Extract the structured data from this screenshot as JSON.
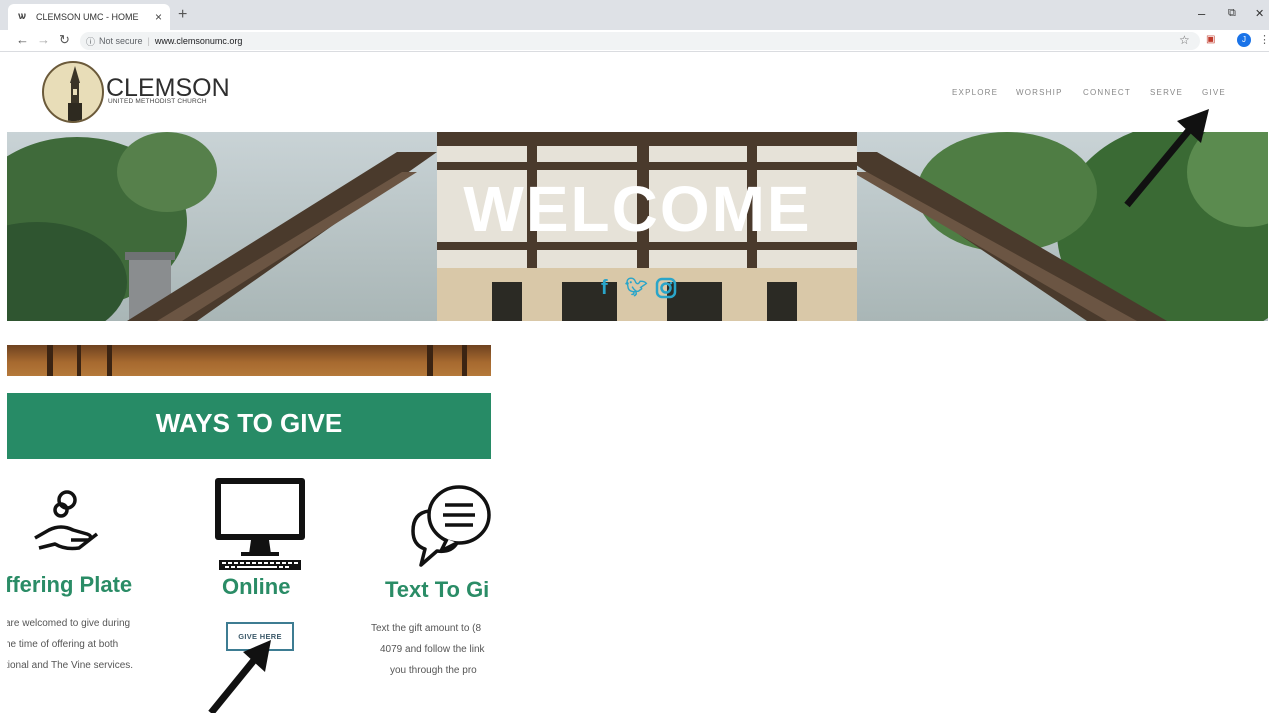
{
  "browser": {
    "tab_title": "CLEMSON UMC - HOME",
    "tab_close": "×",
    "new_tab": "+",
    "security_label": "Not secure",
    "url": "www.clemsonumc.org",
    "avatar_letter": "J",
    "window_controls": {
      "minimize": "–",
      "restore": "⧉",
      "close": "✕"
    }
  },
  "site": {
    "logo_name": "CLEMSON",
    "logo_subtitle": "UNITED METHODIST CHURCH",
    "nav": [
      "EXPLORE",
      "WORSHIP",
      "CONNECT",
      "SERVE",
      "GIVE"
    ],
    "hero_title": "WELCOME",
    "social_icons": [
      "facebook-icon",
      "twitter-icon",
      "instagram-icon"
    ]
  },
  "give_section": {
    "heading": "WAYS TO GIVE",
    "columns": [
      {
        "title": "ffering Plate",
        "icon": "hand-coins-icon",
        "lines": [
          "are welcomed to give during",
          "ne time of offering at both",
          "tional and The Vine services."
        ]
      },
      {
        "title": "Online",
        "icon": "computer-icon",
        "button": "GIVE HERE"
      },
      {
        "title": "Text To Gi",
        "icon": "chat-bubbles-icon",
        "lines": [
          "Text the gift amount to (8",
          "4079 and follow the link",
          "you through the pro"
        ]
      }
    ]
  },
  "colors": {
    "brand_green": "#278b66",
    "button_border": "#3d7c92",
    "annotation_arrow": "#111111"
  }
}
